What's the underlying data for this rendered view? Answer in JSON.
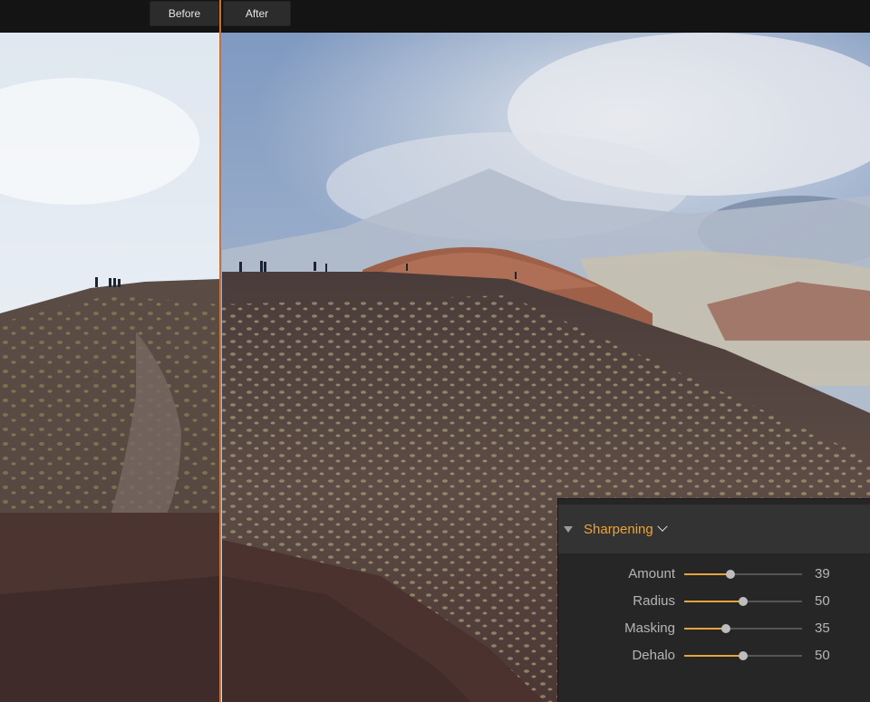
{
  "compare": {
    "before_label": "Before",
    "after_label": "After"
  },
  "colors": {
    "accent": "#e8a33c",
    "divider": "#d26f2a",
    "panel_bg": "#262626",
    "header_bg": "#333333"
  },
  "sharpening": {
    "title": "Sharpening",
    "sliders": [
      {
        "label": "Amount",
        "value": "39",
        "fraction": 0.39
      },
      {
        "label": "Radius",
        "value": "50",
        "fraction": 0.5
      },
      {
        "label": "Masking",
        "value": "35",
        "fraction": 0.35
      },
      {
        "label": "Dehalo",
        "value": "50",
        "fraction": 0.5
      }
    ]
  }
}
